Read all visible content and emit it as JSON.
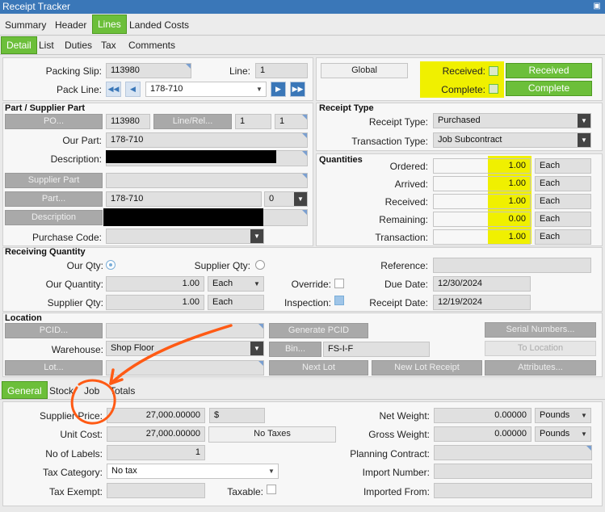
{
  "window": {
    "title": "Receipt Tracker",
    "control_icon": "pin"
  },
  "tabs_main": [
    {
      "label": "Summary"
    },
    {
      "label": "Header"
    },
    {
      "label": "Lines"
    },
    {
      "label": "Landed Costs"
    }
  ],
  "tabs_sub": [
    {
      "label": "Detail"
    },
    {
      "label": "List"
    },
    {
      "label": "Duties"
    },
    {
      "label": "Tax"
    },
    {
      "label": "Comments"
    }
  ],
  "top": {
    "packing_slip_label": "Packing Slip:",
    "packing_slip": "113980",
    "line_label": "Line:",
    "line": "1",
    "pack_line_label": "Pack Line:",
    "pack_line": "178-710",
    "global_label": "Global",
    "received_label": "Received:",
    "received_btn": "Received",
    "complete_label": "Complete:",
    "complete_btn": "Complete"
  },
  "part": {
    "section": "Part / Supplier Part",
    "po_btn": "PO...",
    "po_value": "113980",
    "linerel_btn": "Line/Rel...",
    "line_value": "1",
    "rel_value": "1",
    "our_part_label": "Our Part:",
    "our_part": "178-710",
    "description_label": "Description:",
    "supplier_part_btn": "Supplier Part",
    "part_btn": "Part...",
    "part_value": "178-710",
    "rev_value": "0",
    "description_btn": "Description",
    "purchase_code_label": "Purchase Code:"
  },
  "receipt_type": {
    "section": "Receipt Type",
    "receipt_type_label": "Receipt Type:",
    "receipt_type": "Purchased",
    "transaction_type_label": "Transaction Type:",
    "transaction_type": "Job Subcontract"
  },
  "quantities": {
    "section": "Quantities",
    "rows": [
      {
        "label": "Ordered:",
        "value": "1.00",
        "uom": "Each"
      },
      {
        "label": "Arrived:",
        "value": "1.00",
        "uom": "Each"
      },
      {
        "label": "Received:",
        "value": "1.00",
        "uom": "Each"
      },
      {
        "label": "Remaining:",
        "value": "0.00",
        "uom": "Each"
      },
      {
        "label": "Transaction:",
        "value": "1.00",
        "uom": "Each"
      }
    ]
  },
  "receiving": {
    "section": "Receiving Quantity",
    "our_qty_label": "Our Qty:",
    "supplier_qty_label": "Supplier Qty:",
    "reference_label": "Reference:",
    "our_quantity_label": "Our Quantity:",
    "our_quantity": "1.00",
    "our_uom": "Each",
    "override_label": "Override:",
    "due_date_label": "Due Date:",
    "due_date": "12/30/2024",
    "supplier_qty2_label": "Supplier Qty:",
    "supplier_qty": "1.00",
    "supplier_uom": "Each",
    "inspection_label": "Inspection:",
    "receipt_date_label": "Receipt Date:",
    "receipt_date": "12/19/2024"
  },
  "location": {
    "section": "Location",
    "pcid_btn": "PCID...",
    "generate_pcid_btn": "Generate PCID",
    "serial_numbers_btn": "Serial Numbers...",
    "warehouse_label": "Warehouse:",
    "warehouse": "Shop Floor",
    "bin_btn": "Bin...",
    "bin_value": "FS-I-F",
    "to_location_btn": "To Location",
    "lot_btn": "Lot...",
    "next_lot_btn": "Next Lot",
    "new_lot_receipt_btn": "New Lot Receipt",
    "attributes_btn": "Attributes..."
  },
  "tabs_bottom": [
    {
      "label": "General"
    },
    {
      "label": "Stock"
    },
    {
      "label": "Job"
    },
    {
      "label": "Totals"
    }
  ],
  "general": {
    "supplier_price_label": "Supplier Price:",
    "supplier_price": "27,000.00000",
    "currency": "$",
    "unit_cost_label": "Unit Cost:",
    "unit_cost": "27,000.00000",
    "no_taxes_btn": "No Taxes",
    "labels_label": "No of Labels:",
    "labels": "1",
    "tax_category_label": "Tax Category:",
    "tax_category": "No tax",
    "tax_exempt_label": "Tax Exempt:",
    "taxable_label": "Taxable:",
    "net_weight_label": "Net Weight:",
    "net_weight": "0.00000",
    "net_weight_uom": "Pounds",
    "gross_weight_label": "Gross Weight:",
    "gross_weight": "0.00000",
    "gross_weight_uom": "Pounds",
    "planning_contract_label": "Planning Contract:",
    "import_number_label": "Import Number:",
    "imported_from_label": "Imported From:"
  },
  "colors": {
    "accent": "#6cbf3a",
    "titlebar": "#3a77b8",
    "highlight": "#f0f000",
    "annotation": "#ff5a14"
  }
}
